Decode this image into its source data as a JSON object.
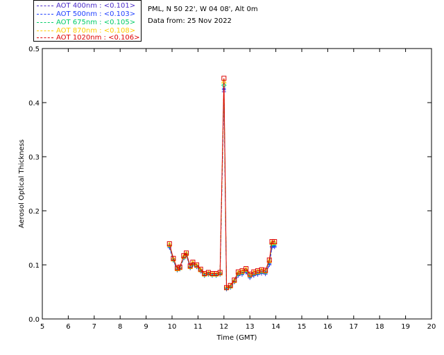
{
  "header": {
    "site": "PML, N 50 22', W 04 08', Alt 0m",
    "date": "Data from: 25 Nov 2022"
  },
  "legend": [
    {
      "label": "AOT  400nm : <0.101>",
      "color": "#4b2cc9"
    },
    {
      "label": "AOT  500nm : <0.103>",
      "color": "#1f3fff"
    },
    {
      "label": "AOT  675nm : <0.105>",
      "color": "#00cc66"
    },
    {
      "label": "AOT  870nm : <0.108>",
      "color": "#ffcc00"
    },
    {
      "label": "AOT 1020nm : <0.106>",
      "color": "#dd0000"
    }
  ],
  "chart_data": {
    "type": "line",
    "xlabel": "Time (GMT)",
    "ylabel": "Aerosol Optical Thickness",
    "xlim": [
      5,
      20
    ],
    "ylim": [
      0.0,
      0.5
    ],
    "xticks": [
      5,
      6,
      7,
      8,
      9,
      10,
      11,
      12,
      13,
      14,
      15,
      16,
      17,
      18,
      19,
      20
    ],
    "yticks": [
      0.0,
      0.1,
      0.2,
      0.3,
      0.4,
      0.5
    ],
    "x": [
      9.9,
      10.05,
      10.2,
      10.3,
      10.45,
      10.55,
      10.7,
      10.8,
      10.95,
      11.1,
      11.25,
      11.4,
      11.55,
      11.7,
      11.85,
      12.0,
      12.1,
      12.25,
      12.4,
      12.55,
      12.7,
      12.85,
      13.0,
      13.15,
      13.3,
      13.45,
      13.6,
      13.75,
      13.85,
      13.95
    ],
    "series": [
      {
        "name": "AOT  400nm : <0.101>",
        "values": [
          0.132,
          0.108,
          0.09,
          0.092,
          0.112,
          0.118,
          0.094,
          0.1,
          0.096,
          0.088,
          0.08,
          0.082,
          0.08,
          0.08,
          0.082,
          0.42,
          0.055,
          0.058,
          0.068,
          0.08,
          0.082,
          0.086,
          0.076,
          0.08,
          0.082,
          0.084,
          0.083,
          0.1,
          0.132,
          0.133
        ]
      },
      {
        "name": "AOT  500nm : <0.103>",
        "values": [
          0.134,
          0.109,
          0.091,
          0.093,
          0.113,
          0.119,
          0.095,
          0.101,
          0.097,
          0.089,
          0.081,
          0.083,
          0.081,
          0.081,
          0.083,
          0.425,
          0.056,
          0.059,
          0.069,
          0.082,
          0.084,
          0.088,
          0.078,
          0.082,
          0.084,
          0.086,
          0.085,
          0.102,
          0.134,
          0.135
        ]
      },
      {
        "name": "AOT  675nm : <0.105>",
        "values": [
          0.136,
          0.11,
          0.092,
          0.094,
          0.114,
          0.12,
          0.096,
          0.102,
          0.098,
          0.09,
          0.082,
          0.084,
          0.082,
          0.082,
          0.084,
          0.432,
          0.057,
          0.06,
          0.07,
          0.084,
          0.086,
          0.09,
          0.08,
          0.084,
          0.086,
          0.088,
          0.087,
          0.106,
          0.138,
          0.139
        ]
      },
      {
        "name": "AOT  870nm : <0.108>",
        "values": [
          0.138,
          0.111,
          0.093,
          0.095,
          0.116,
          0.121,
          0.097,
          0.104,
          0.099,
          0.091,
          0.083,
          0.085,
          0.083,
          0.083,
          0.085,
          0.44,
          0.058,
          0.061,
          0.071,
          0.086,
          0.088,
          0.092,
          0.082,
          0.086,
          0.088,
          0.09,
          0.089,
          0.108,
          0.142,
          0.142
        ]
      },
      {
        "name": "AOT 1020nm : <0.106>",
        "values": [
          0.139,
          0.112,
          0.094,
          0.096,
          0.117,
          0.122,
          0.098,
          0.105,
          0.1,
          0.092,
          0.084,
          0.086,
          0.084,
          0.084,
          0.086,
          0.445,
          0.058,
          0.062,
          0.072,
          0.087,
          0.089,
          0.093,
          0.083,
          0.087,
          0.089,
          0.091,
          0.09,
          0.109,
          0.143,
          0.143
        ]
      }
    ]
  }
}
